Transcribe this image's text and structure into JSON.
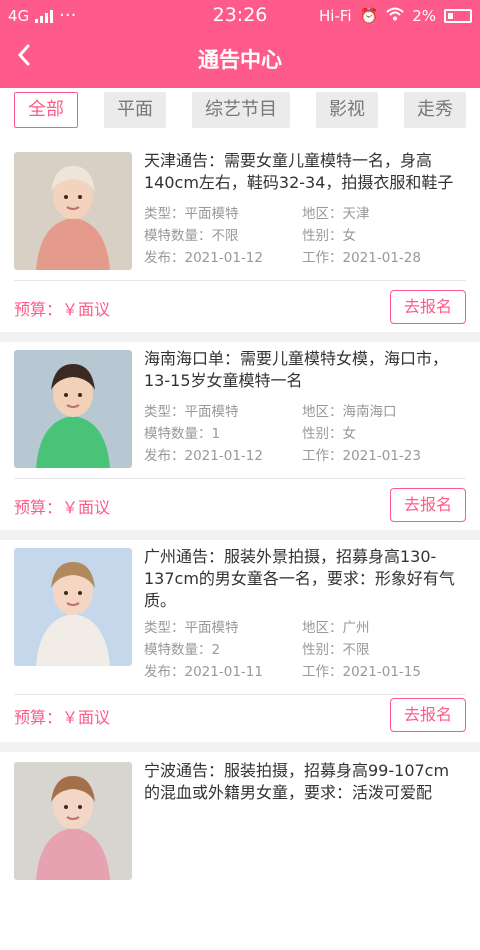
{
  "status_bar": {
    "network": "4G",
    "dots": "···",
    "time": "23:26",
    "hifi": "Hi-Fi",
    "battery": "2%"
  },
  "header": {
    "title": "通告中心"
  },
  "tabs": [
    {
      "label": "全部",
      "active": true
    },
    {
      "label": "平面",
      "active": false
    },
    {
      "label": "综艺节目",
      "active": false
    },
    {
      "label": "影视",
      "active": false
    },
    {
      "label": "走秀",
      "active": false
    }
  ],
  "cards": [
    {
      "title": "天津通告：需要女童儿童模特一名，身高140cm左右，鞋码32-34，拍摄衣服和鞋子",
      "type": "类型：平面模特",
      "region": "地区：天津",
      "count": "模特数量：不限",
      "gender": "性别：女",
      "publish": "发布：2021-01-12",
      "work": "工作：2021-01-28",
      "budget": "预算：￥面议",
      "apply": "去报名",
      "thumb_colors": {
        "bg": "#d9d0c5",
        "coat": "#e49b8c",
        "skin": "#f3d3bd",
        "hat": "#eee5d8"
      }
    },
    {
      "title": "海南海口单：需要儿童模特女模，海口市，13-15岁女童模特一名",
      "type": "类型：平面模特",
      "region": "地区：海南海口",
      "count": "模特数量：1",
      "gender": "性别：女",
      "publish": "发布：2021-01-12",
      "work": "工作：2021-01-23",
      "budget": "预算：￥面议",
      "apply": "去报名",
      "thumb_colors": {
        "bg": "#b7c8d3",
        "coat": "#49c378",
        "skin": "#f2d1b9",
        "hat": "#3a2a22"
      }
    },
    {
      "title": "广州通告：服装外景拍摄，招募身高130-137cm的男女童各一名，要求：形象好有气质。",
      "type": "类型：平面模特",
      "region": "地区：广州",
      "count": "模特数量：2",
      "gender": "性别：不限",
      "publish": "发布：2021-01-11",
      "work": "工作：2021-01-15",
      "budget": "预算：￥面议",
      "apply": "去报名",
      "thumb_colors": {
        "bg": "#c5d7ea",
        "coat": "#f1ece6",
        "skin": "#f4d6c3",
        "hat": "#b08a5d"
      }
    },
    {
      "title": "宁波通告：服装拍摄，招募身高99-107cm的混血或外籍男女童，要求：活泼可爱配",
      "type": "",
      "region": "",
      "count": "",
      "gender": "",
      "publish": "",
      "work": "",
      "budget": "",
      "apply": "",
      "thumb_colors": {
        "bg": "#d8d4d0",
        "coat": "#e6a2ae",
        "skin": "#f3d6c6",
        "hat": "#a56f4a"
      }
    }
  ]
}
